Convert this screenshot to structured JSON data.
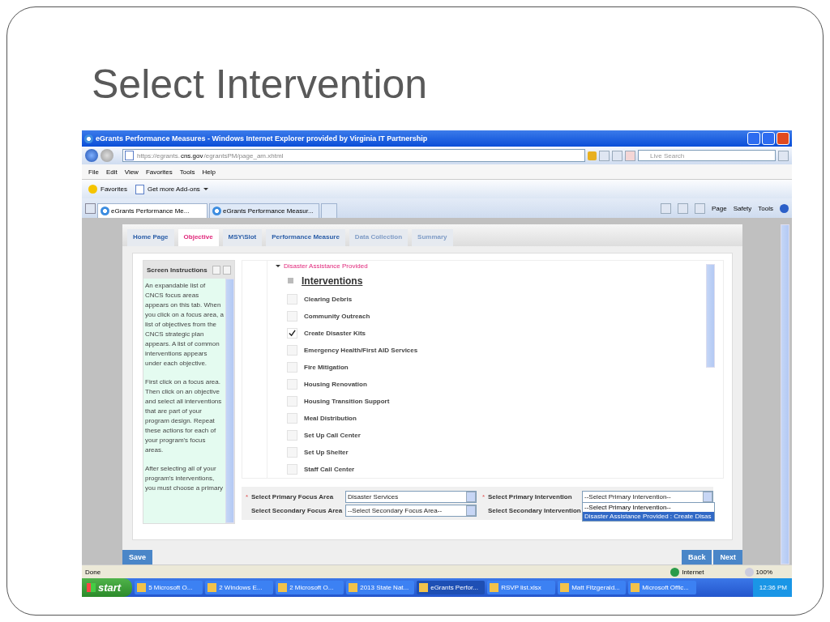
{
  "slide": {
    "title": "Select Intervention"
  },
  "browser": {
    "title": "eGrants Performance Measures - Windows Internet Explorer provided by Virginia IT Partnership",
    "address": {
      "prefix": "https://egrants.",
      "domain": "cns.gov",
      "path": "/egrantsPM/page_am.xhtml"
    },
    "search": {
      "placeholder": "Live Search"
    },
    "menu": [
      "File",
      "Edit",
      "View",
      "Favorites",
      "Tools",
      "Help"
    ],
    "favorites": {
      "label": "Favorites",
      "addons": "Get more Add-ons"
    },
    "tabs": [
      {
        "label": "eGrants Performance Me...",
        "selected": true
      },
      {
        "label": "eGrants Performance Measur...",
        "selected": false
      }
    ],
    "commands": [
      "Page",
      "Safety",
      "Tools"
    ]
  },
  "app": {
    "tabs": [
      {
        "label": "Home Page",
        "selected": false,
        "disabled": false
      },
      {
        "label": "Objective",
        "selected": true,
        "disabled": false
      },
      {
        "label": "MSY\\Slot",
        "selected": false,
        "disabled": false
      },
      {
        "label": "Performance Measure",
        "selected": false,
        "disabled": false
      },
      {
        "label": "Data Collection",
        "selected": false,
        "disabled": true
      },
      {
        "label": "Summary",
        "selected": false,
        "disabled": true
      }
    ],
    "instructions": {
      "title": "Screen Instructions",
      "paragraphs": [
        "An expandable list of CNCS focus areas appears on this tab. When you click on a focus area, a list of objectives from the CNCS strategic plan appears. A list of common interventions appears under each objective.",
        "First click on a focus area. Then click on an objective and select all interventions that are part of your program design. Repeat these actions for each of your program's focus areas.",
        "After selecting all of your program's interventions, you must choose a primary"
      ]
    },
    "objective": "Disaster Assistance Provided",
    "interventions_heading": "Interventions",
    "interventions": [
      {
        "label": "Clearing Debris",
        "checked": false
      },
      {
        "label": "Community Outreach",
        "checked": false
      },
      {
        "label": "Create Disaster Kits",
        "checked": true
      },
      {
        "label": "Emergency Health/First AID Services",
        "checked": false
      },
      {
        "label": "Fire Mitigation",
        "checked": false
      },
      {
        "label": "Housing Renovation",
        "checked": false
      },
      {
        "label": "Housing Transition Support",
        "checked": false
      },
      {
        "label": "Meal Distribution",
        "checked": false
      },
      {
        "label": "Set Up Call Center",
        "checked": false
      },
      {
        "label": "Set Up Shelter",
        "checked": false
      },
      {
        "label": "Staff Call Center",
        "checked": false
      }
    ],
    "required_mark": "*",
    "fields": [
      {
        "label": "Select Primary Focus Area",
        "required": true,
        "value": "Disaster Services"
      },
      {
        "label": "Select Primary Intervention",
        "required": true,
        "value": "--Select Primary Intervention--"
      },
      {
        "label": "Select Secondary Focus Area",
        "required": false,
        "value": "--Select Secondary Focus Area--"
      },
      {
        "label": "Select Secondary Intervention",
        "required": false
      }
    ],
    "dropdown_options": [
      {
        "label": "--Select Primary Intervention--",
        "selected": false
      },
      {
        "label": "Disaster Assistance Provided : Create Disas",
        "selected": true
      }
    ],
    "save": "Save",
    "back": "Back",
    "next": "Next"
  },
  "status_bar": {
    "text": "Done",
    "zone": "Internet",
    "zoom": "100%"
  },
  "taskbar": {
    "start": "start",
    "items": [
      {
        "label": "5 Microsoft O...",
        "selected": false
      },
      {
        "label": "2 Windows E...",
        "selected": false
      },
      {
        "label": "2 Microsoft O...",
        "selected": false
      },
      {
        "label": "2013 State Nat...",
        "selected": false
      },
      {
        "label": "eGrants Perfor...",
        "selected": true
      },
      {
        "label": "RSVP list.xlsx",
        "selected": false
      },
      {
        "label": "Matt Fitzgerald...",
        "selected": false
      },
      {
        "label": "Microsoft Offic...",
        "selected": false
      }
    ],
    "clock": "12:36 PM"
  }
}
